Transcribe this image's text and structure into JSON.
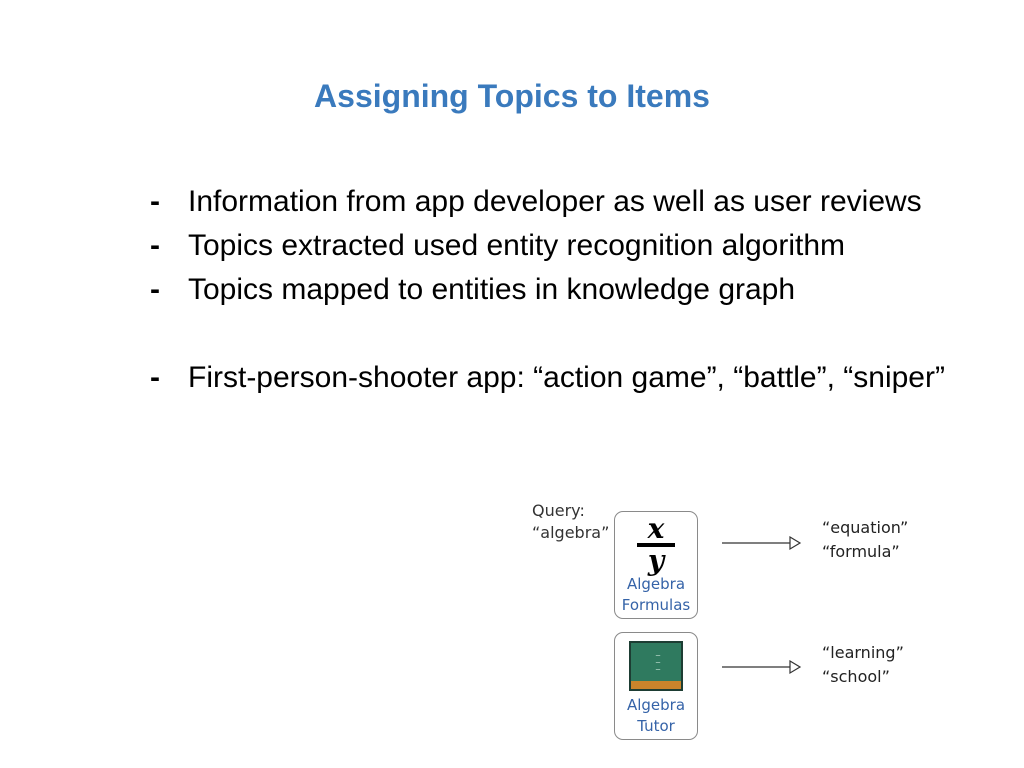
{
  "slide": {
    "title": "Assigning Topics to Items",
    "bullets": [
      {
        "dash": "-",
        "text": "Information from app developer as well as user reviews"
      },
      {
        "dash": "-",
        "text": "Topics extracted used entity recognition algorithm"
      },
      {
        "dash": "-",
        "text": "Topics mapped to entities in knowledge graph"
      },
      {
        "dash": "-",
        "text": "First-person-shooter app: “action game”, “battle”, “sniper”"
      }
    ]
  },
  "figure": {
    "query_label": "Query:",
    "query_value": "“algebra”",
    "apps": [
      {
        "icon": "fraction-x-over-y-icon",
        "icon_text": {
          "numerator": "x",
          "denominator": "y"
        },
        "name_line1": "Algebra",
        "name_line2": "Formulas",
        "topics": [
          "“equation”",
          "“formula”"
        ]
      },
      {
        "icon": "chalkboard-icon",
        "name_line1": "Algebra",
        "name_line2": "Tutor",
        "topics": [
          "“learning”",
          "“school”"
        ]
      }
    ]
  },
  "colors": {
    "title": "#3a7abd",
    "app_name": "#3563a8",
    "card_border": "#8a8a8a"
  }
}
